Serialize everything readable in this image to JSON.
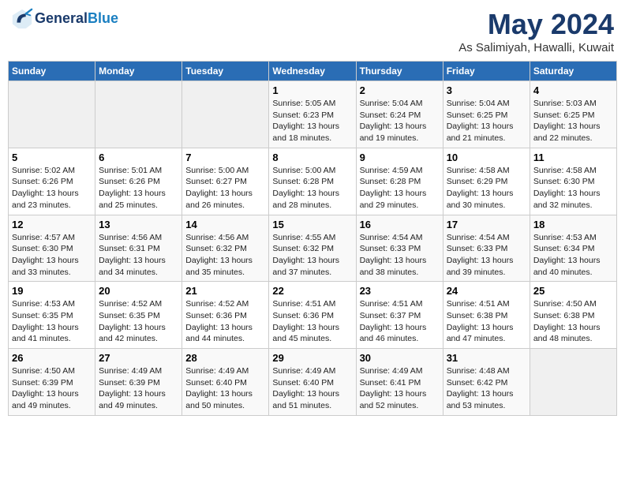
{
  "header": {
    "logo_line1": "General",
    "logo_line2": "Blue",
    "title": "May 2024",
    "subtitle": "As Salimiyah, Hawalli, Kuwait"
  },
  "weekdays": [
    "Sunday",
    "Monday",
    "Tuesday",
    "Wednesday",
    "Thursday",
    "Friday",
    "Saturday"
  ],
  "weeks": [
    [
      {
        "day": "",
        "info": ""
      },
      {
        "day": "",
        "info": ""
      },
      {
        "day": "",
        "info": ""
      },
      {
        "day": "1",
        "info": "Sunrise: 5:05 AM\nSunset: 6:23 PM\nDaylight: 13 hours\nand 18 minutes."
      },
      {
        "day": "2",
        "info": "Sunrise: 5:04 AM\nSunset: 6:24 PM\nDaylight: 13 hours\nand 19 minutes."
      },
      {
        "day": "3",
        "info": "Sunrise: 5:04 AM\nSunset: 6:25 PM\nDaylight: 13 hours\nand 21 minutes."
      },
      {
        "day": "4",
        "info": "Sunrise: 5:03 AM\nSunset: 6:25 PM\nDaylight: 13 hours\nand 22 minutes."
      }
    ],
    [
      {
        "day": "5",
        "info": "Sunrise: 5:02 AM\nSunset: 6:26 PM\nDaylight: 13 hours\nand 23 minutes."
      },
      {
        "day": "6",
        "info": "Sunrise: 5:01 AM\nSunset: 6:26 PM\nDaylight: 13 hours\nand 25 minutes."
      },
      {
        "day": "7",
        "info": "Sunrise: 5:00 AM\nSunset: 6:27 PM\nDaylight: 13 hours\nand 26 minutes."
      },
      {
        "day": "8",
        "info": "Sunrise: 5:00 AM\nSunset: 6:28 PM\nDaylight: 13 hours\nand 28 minutes."
      },
      {
        "day": "9",
        "info": "Sunrise: 4:59 AM\nSunset: 6:28 PM\nDaylight: 13 hours\nand 29 minutes."
      },
      {
        "day": "10",
        "info": "Sunrise: 4:58 AM\nSunset: 6:29 PM\nDaylight: 13 hours\nand 30 minutes."
      },
      {
        "day": "11",
        "info": "Sunrise: 4:58 AM\nSunset: 6:30 PM\nDaylight: 13 hours\nand 32 minutes."
      }
    ],
    [
      {
        "day": "12",
        "info": "Sunrise: 4:57 AM\nSunset: 6:30 PM\nDaylight: 13 hours\nand 33 minutes."
      },
      {
        "day": "13",
        "info": "Sunrise: 4:56 AM\nSunset: 6:31 PM\nDaylight: 13 hours\nand 34 minutes."
      },
      {
        "day": "14",
        "info": "Sunrise: 4:56 AM\nSunset: 6:32 PM\nDaylight: 13 hours\nand 35 minutes."
      },
      {
        "day": "15",
        "info": "Sunrise: 4:55 AM\nSunset: 6:32 PM\nDaylight: 13 hours\nand 37 minutes."
      },
      {
        "day": "16",
        "info": "Sunrise: 4:54 AM\nSunset: 6:33 PM\nDaylight: 13 hours\nand 38 minutes."
      },
      {
        "day": "17",
        "info": "Sunrise: 4:54 AM\nSunset: 6:33 PM\nDaylight: 13 hours\nand 39 minutes."
      },
      {
        "day": "18",
        "info": "Sunrise: 4:53 AM\nSunset: 6:34 PM\nDaylight: 13 hours\nand 40 minutes."
      }
    ],
    [
      {
        "day": "19",
        "info": "Sunrise: 4:53 AM\nSunset: 6:35 PM\nDaylight: 13 hours\nand 41 minutes."
      },
      {
        "day": "20",
        "info": "Sunrise: 4:52 AM\nSunset: 6:35 PM\nDaylight: 13 hours\nand 42 minutes."
      },
      {
        "day": "21",
        "info": "Sunrise: 4:52 AM\nSunset: 6:36 PM\nDaylight: 13 hours\nand 44 minutes."
      },
      {
        "day": "22",
        "info": "Sunrise: 4:51 AM\nSunset: 6:36 PM\nDaylight: 13 hours\nand 45 minutes."
      },
      {
        "day": "23",
        "info": "Sunrise: 4:51 AM\nSunset: 6:37 PM\nDaylight: 13 hours\nand 46 minutes."
      },
      {
        "day": "24",
        "info": "Sunrise: 4:51 AM\nSunset: 6:38 PM\nDaylight: 13 hours\nand 47 minutes."
      },
      {
        "day": "25",
        "info": "Sunrise: 4:50 AM\nSunset: 6:38 PM\nDaylight: 13 hours\nand 48 minutes."
      }
    ],
    [
      {
        "day": "26",
        "info": "Sunrise: 4:50 AM\nSunset: 6:39 PM\nDaylight: 13 hours\nand 49 minutes."
      },
      {
        "day": "27",
        "info": "Sunrise: 4:49 AM\nSunset: 6:39 PM\nDaylight: 13 hours\nand 49 minutes."
      },
      {
        "day": "28",
        "info": "Sunrise: 4:49 AM\nSunset: 6:40 PM\nDaylight: 13 hours\nand 50 minutes."
      },
      {
        "day": "29",
        "info": "Sunrise: 4:49 AM\nSunset: 6:40 PM\nDaylight: 13 hours\nand 51 minutes."
      },
      {
        "day": "30",
        "info": "Sunrise: 4:49 AM\nSunset: 6:41 PM\nDaylight: 13 hours\nand 52 minutes."
      },
      {
        "day": "31",
        "info": "Sunrise: 4:48 AM\nSunset: 6:42 PM\nDaylight: 13 hours\nand 53 minutes."
      },
      {
        "day": "",
        "info": ""
      }
    ]
  ]
}
